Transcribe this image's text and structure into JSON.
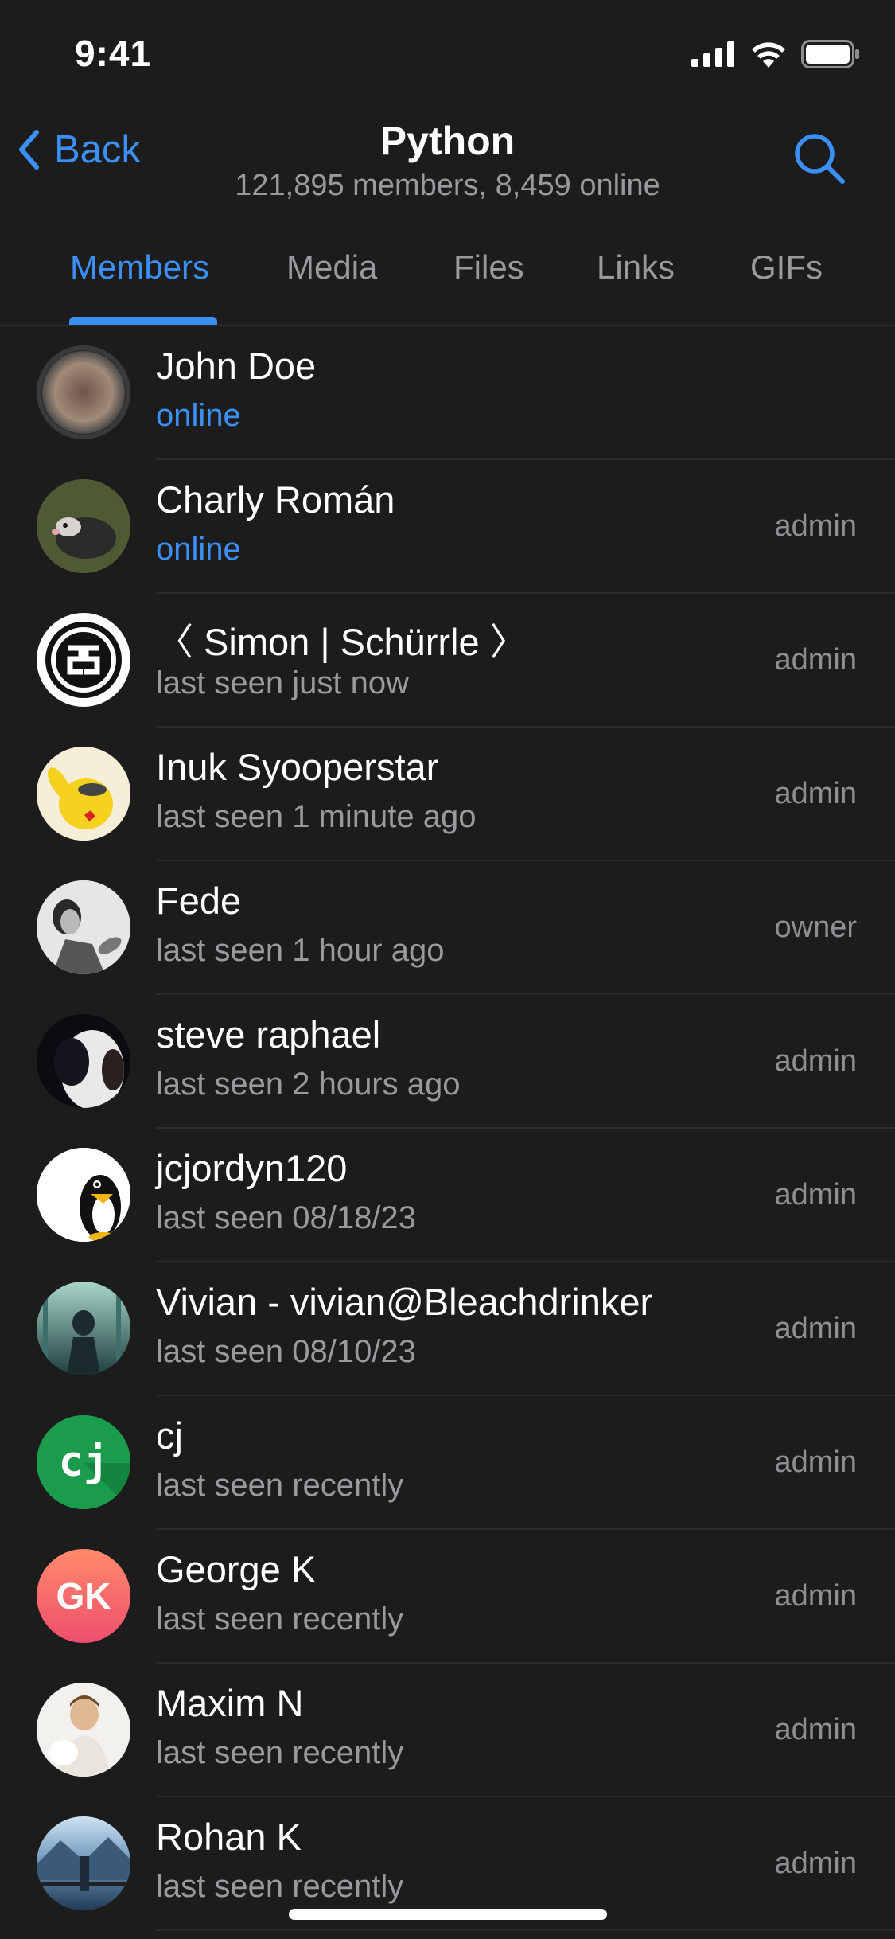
{
  "status_bar": {
    "time": "9:41"
  },
  "nav": {
    "back_label": "Back",
    "title": "Python",
    "subtitle": "121,895 members, 8,459 online"
  },
  "tabs": [
    {
      "label": "Members",
      "active": true
    },
    {
      "label": "Media",
      "active": false
    },
    {
      "label": "Files",
      "active": false
    },
    {
      "label": "Links",
      "active": false
    },
    {
      "label": "GIFs",
      "active": false
    }
  ],
  "members": [
    {
      "name": "John Doe",
      "status": "online",
      "role": ""
    },
    {
      "name": "Charly Román",
      "status": "online",
      "role": "admin"
    },
    {
      "name": "〈 Simon | Schürrle 〉",
      "status": "last seen just now",
      "role": "admin"
    },
    {
      "name": "Inuk Syooperstar",
      "status": "last seen 1 minute ago",
      "role": "admin"
    },
    {
      "name": "Fede",
      "status": "last seen 1 hour ago",
      "role": "owner"
    },
    {
      "name": "steve raphael",
      "status": "last seen 2 hours ago",
      "role": "admin"
    },
    {
      "name": "jcjordyn120",
      "status": "last seen 08/18/23",
      "role": "admin"
    },
    {
      "name": "Vivian - vivian@Bleachdrinker",
      "status": "last seen 08/10/23",
      "role": "admin"
    },
    {
      "name": "cj",
      "status": "last seen recently",
      "role": "admin",
      "avatar_text": "cj"
    },
    {
      "name": "George K",
      "status": "last seen recently",
      "role": "admin",
      "avatar_text": "GK"
    },
    {
      "name": "Maxim N",
      "status": "last seen recently",
      "role": "admin"
    },
    {
      "name": "Rohan K",
      "status": "last seen recently",
      "role": "admin"
    }
  ],
  "colors": {
    "accent": "#3b8ff5",
    "background": "#1c1c1d",
    "secondary_text": "#9a9a9e"
  }
}
